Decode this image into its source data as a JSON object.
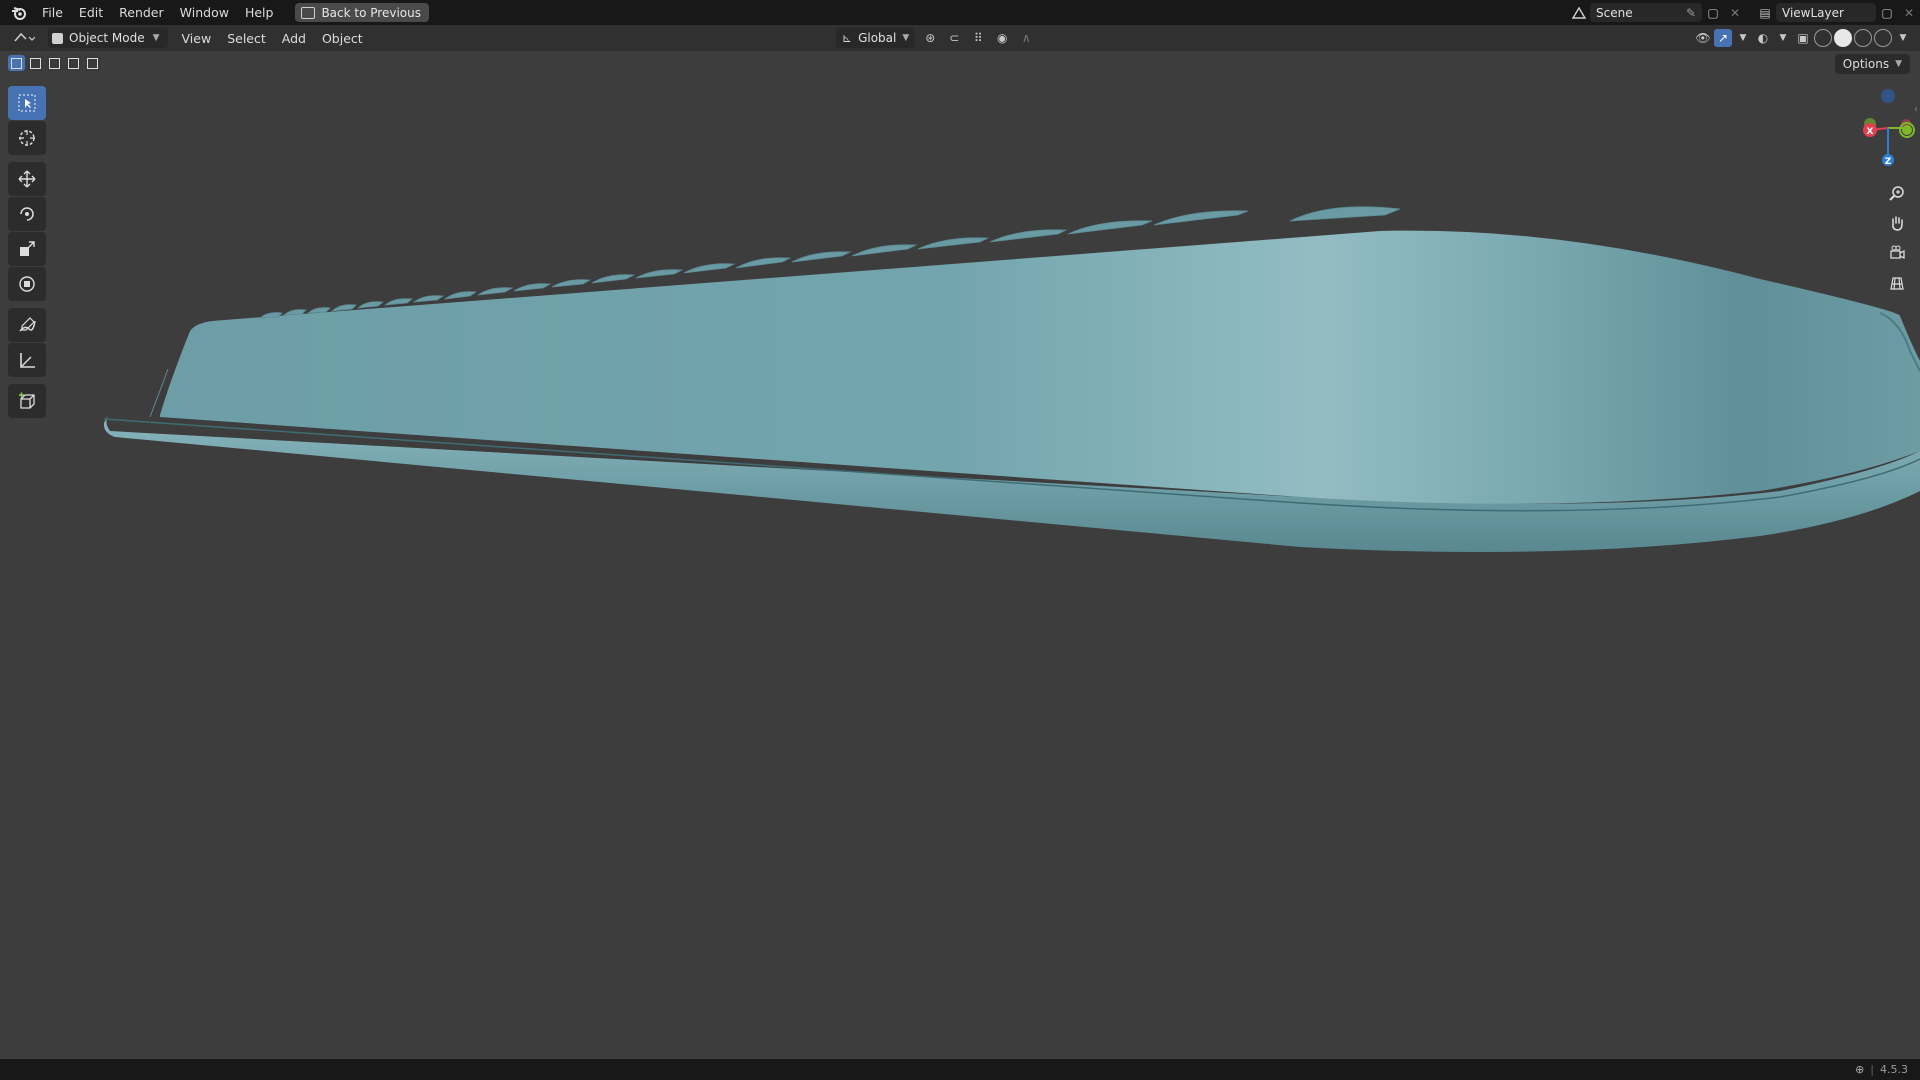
{
  "topbar": {
    "menus": [
      "File",
      "Edit",
      "Render",
      "Window",
      "Help"
    ],
    "back_button": "Back to Previous",
    "scene": "Scene",
    "view_layer": "ViewLayer"
  },
  "header": {
    "mode": "Object Mode",
    "menus": [
      "View",
      "Select",
      "Add",
      "Object"
    ],
    "transform_orientation": "Global",
    "options": "Options"
  },
  "gizmo": {
    "x_label": "X",
    "y_label": "Y",
    "z_label": "Z",
    "x_color": "#e0404f",
    "y_color": "#7fb92a",
    "z_color": "#2e7dd6"
  },
  "toolbar": {
    "tools": [
      "select-box",
      "cursor",
      "move",
      "rotate",
      "scale",
      "transform",
      "annotate",
      "measure",
      "add-cube"
    ]
  },
  "statusbar": {
    "version": "4.5.3"
  },
  "colors": {
    "accent": "#4772b3",
    "model": "#6fa1aa",
    "background": "#3d3d3d"
  }
}
